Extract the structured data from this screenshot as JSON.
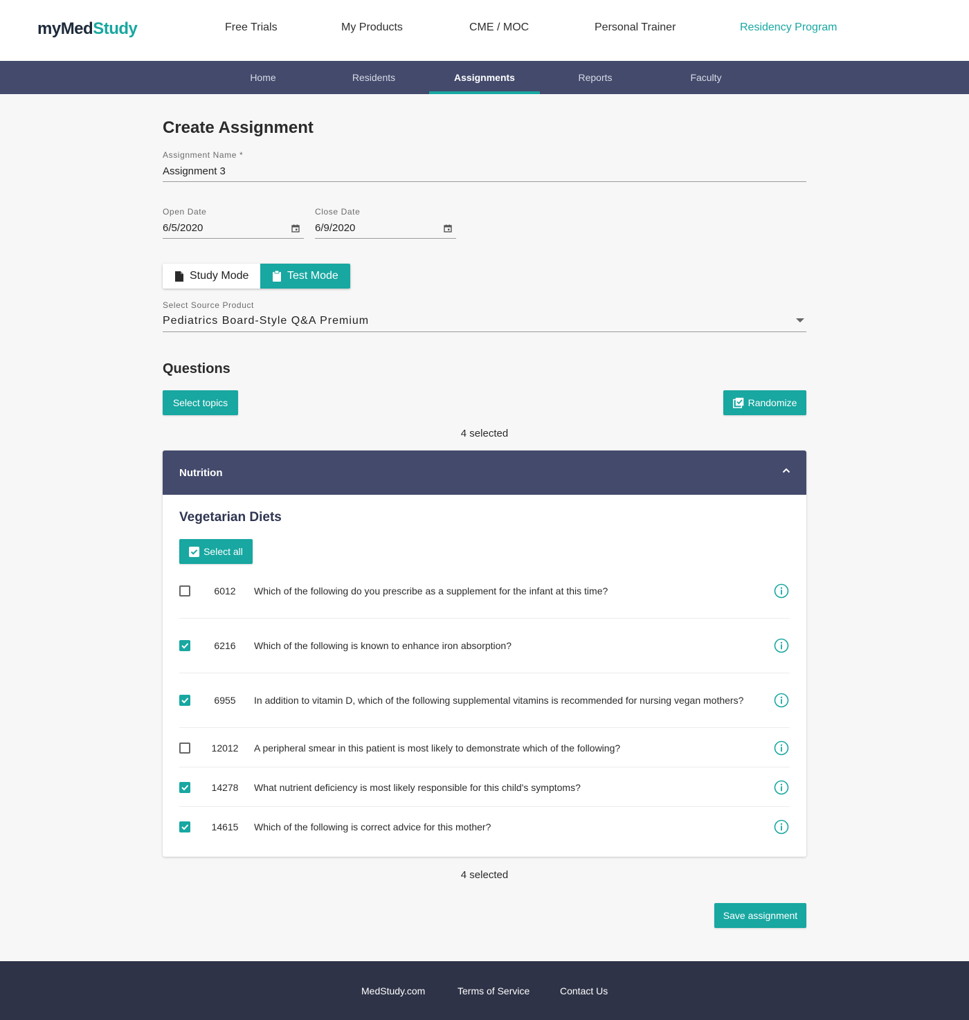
{
  "header": {
    "logo": {
      "my": "my",
      "med": "Med",
      "study": "Study"
    },
    "nav": [
      "Free Trials",
      "My Products",
      "CME / MOC",
      "Personal Trainer",
      "Residency Program"
    ]
  },
  "subnav": [
    "Home",
    "Residents",
    "Assignments",
    "Reports",
    "Faculty"
  ],
  "form": {
    "title": "Create Assignment",
    "assignment_name_label": "Assignment Name *",
    "assignment_name": "Assignment 3",
    "open_date_label": "Open Date",
    "open_date": "6/5/2020",
    "close_date_label": "Close Date",
    "close_date": "6/9/2020",
    "mode_study": "Study Mode",
    "mode_test": "Test Mode",
    "source_label": "Select Source Product",
    "source_value": "Pediatrics Board-Style Q&A Premium"
  },
  "questions": {
    "title": "Questions",
    "select_topics": "Select topics",
    "randomize": "Randomize",
    "selected_top": "4 selected",
    "selected_bottom": "4 selected",
    "topic": "Nutrition",
    "subtopic": "Vegetarian Diets",
    "select_all": "Select all",
    "items": [
      {
        "id": "6012",
        "text": "Which of the following do you prescribe as a supplement for the infant at this time?",
        "checked": false
      },
      {
        "id": "6216",
        "text": "Which of the following is known to enhance iron absorption?",
        "checked": true
      },
      {
        "id": "6955",
        "text": "In addition to vitamin D, which of the following supplemental vitamins is recommended for nursing vegan mothers?",
        "checked": true
      },
      {
        "id": "12012",
        "text": "A peripheral smear in this patient is most likely to demonstrate which of the following?",
        "checked": false
      },
      {
        "id": "14278",
        "text": "What nutrient deficiency is most likely responsible for this child's symptoms?",
        "checked": true
      },
      {
        "id": "14615",
        "text": "Which of the following is correct advice for this mother?",
        "checked": true
      }
    ],
    "save": "Save assignment"
  },
  "footer": [
    "MedStudy.com",
    "Terms of Service",
    "Contact Us"
  ],
  "colors": {
    "accent": "#18a7a1",
    "navy": "#434a6c",
    "footer": "#2e3347"
  }
}
